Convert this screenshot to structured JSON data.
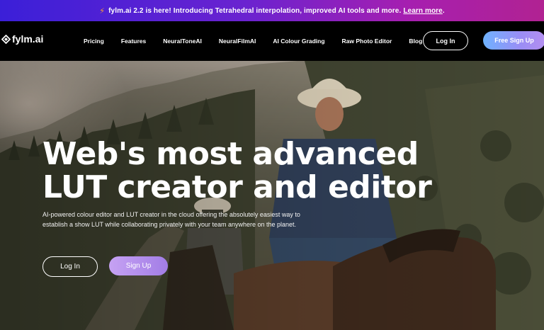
{
  "announcement": {
    "message": "fylm.ai 2.2 is here! Introducing Tetrahedral interpolation, improved AI tools and more.",
    "link_label": "Learn more",
    "trailing": "."
  },
  "nav": {
    "logo_text": "fylm.ai",
    "links": [
      "Pricing",
      "Features",
      "NeuralToneAI",
      "NeuralFilmAI",
      "AI Colour Grading",
      "Raw Photo Editor",
      "Blog"
    ],
    "login_label": "Log In",
    "signup_label": "Free Sign Up"
  },
  "hero": {
    "headline_line1": "Web's most advanced",
    "headline_line2": "LUT creator and editor",
    "subtext_line1": "AI-powered colour editor and LUT creator in the cloud offering the absolutely easiest way to",
    "subtext_line2": "establish a show LUT while collaborating privately with your team anywhere on the planet.",
    "login_label": "Log In",
    "signup_label": "Sign Up"
  },
  "colors": {
    "announce_gradient": [
      "#3b1fd8",
      "#a61fb0"
    ],
    "signup_gradient": [
      "#6fb2ff",
      "#b48ff0"
    ],
    "hero_signup": "#b08cec",
    "bolt": "#ff9f2e"
  },
  "icons": [
    "lightning-bolt-icon",
    "fylm-logo-icon"
  ]
}
